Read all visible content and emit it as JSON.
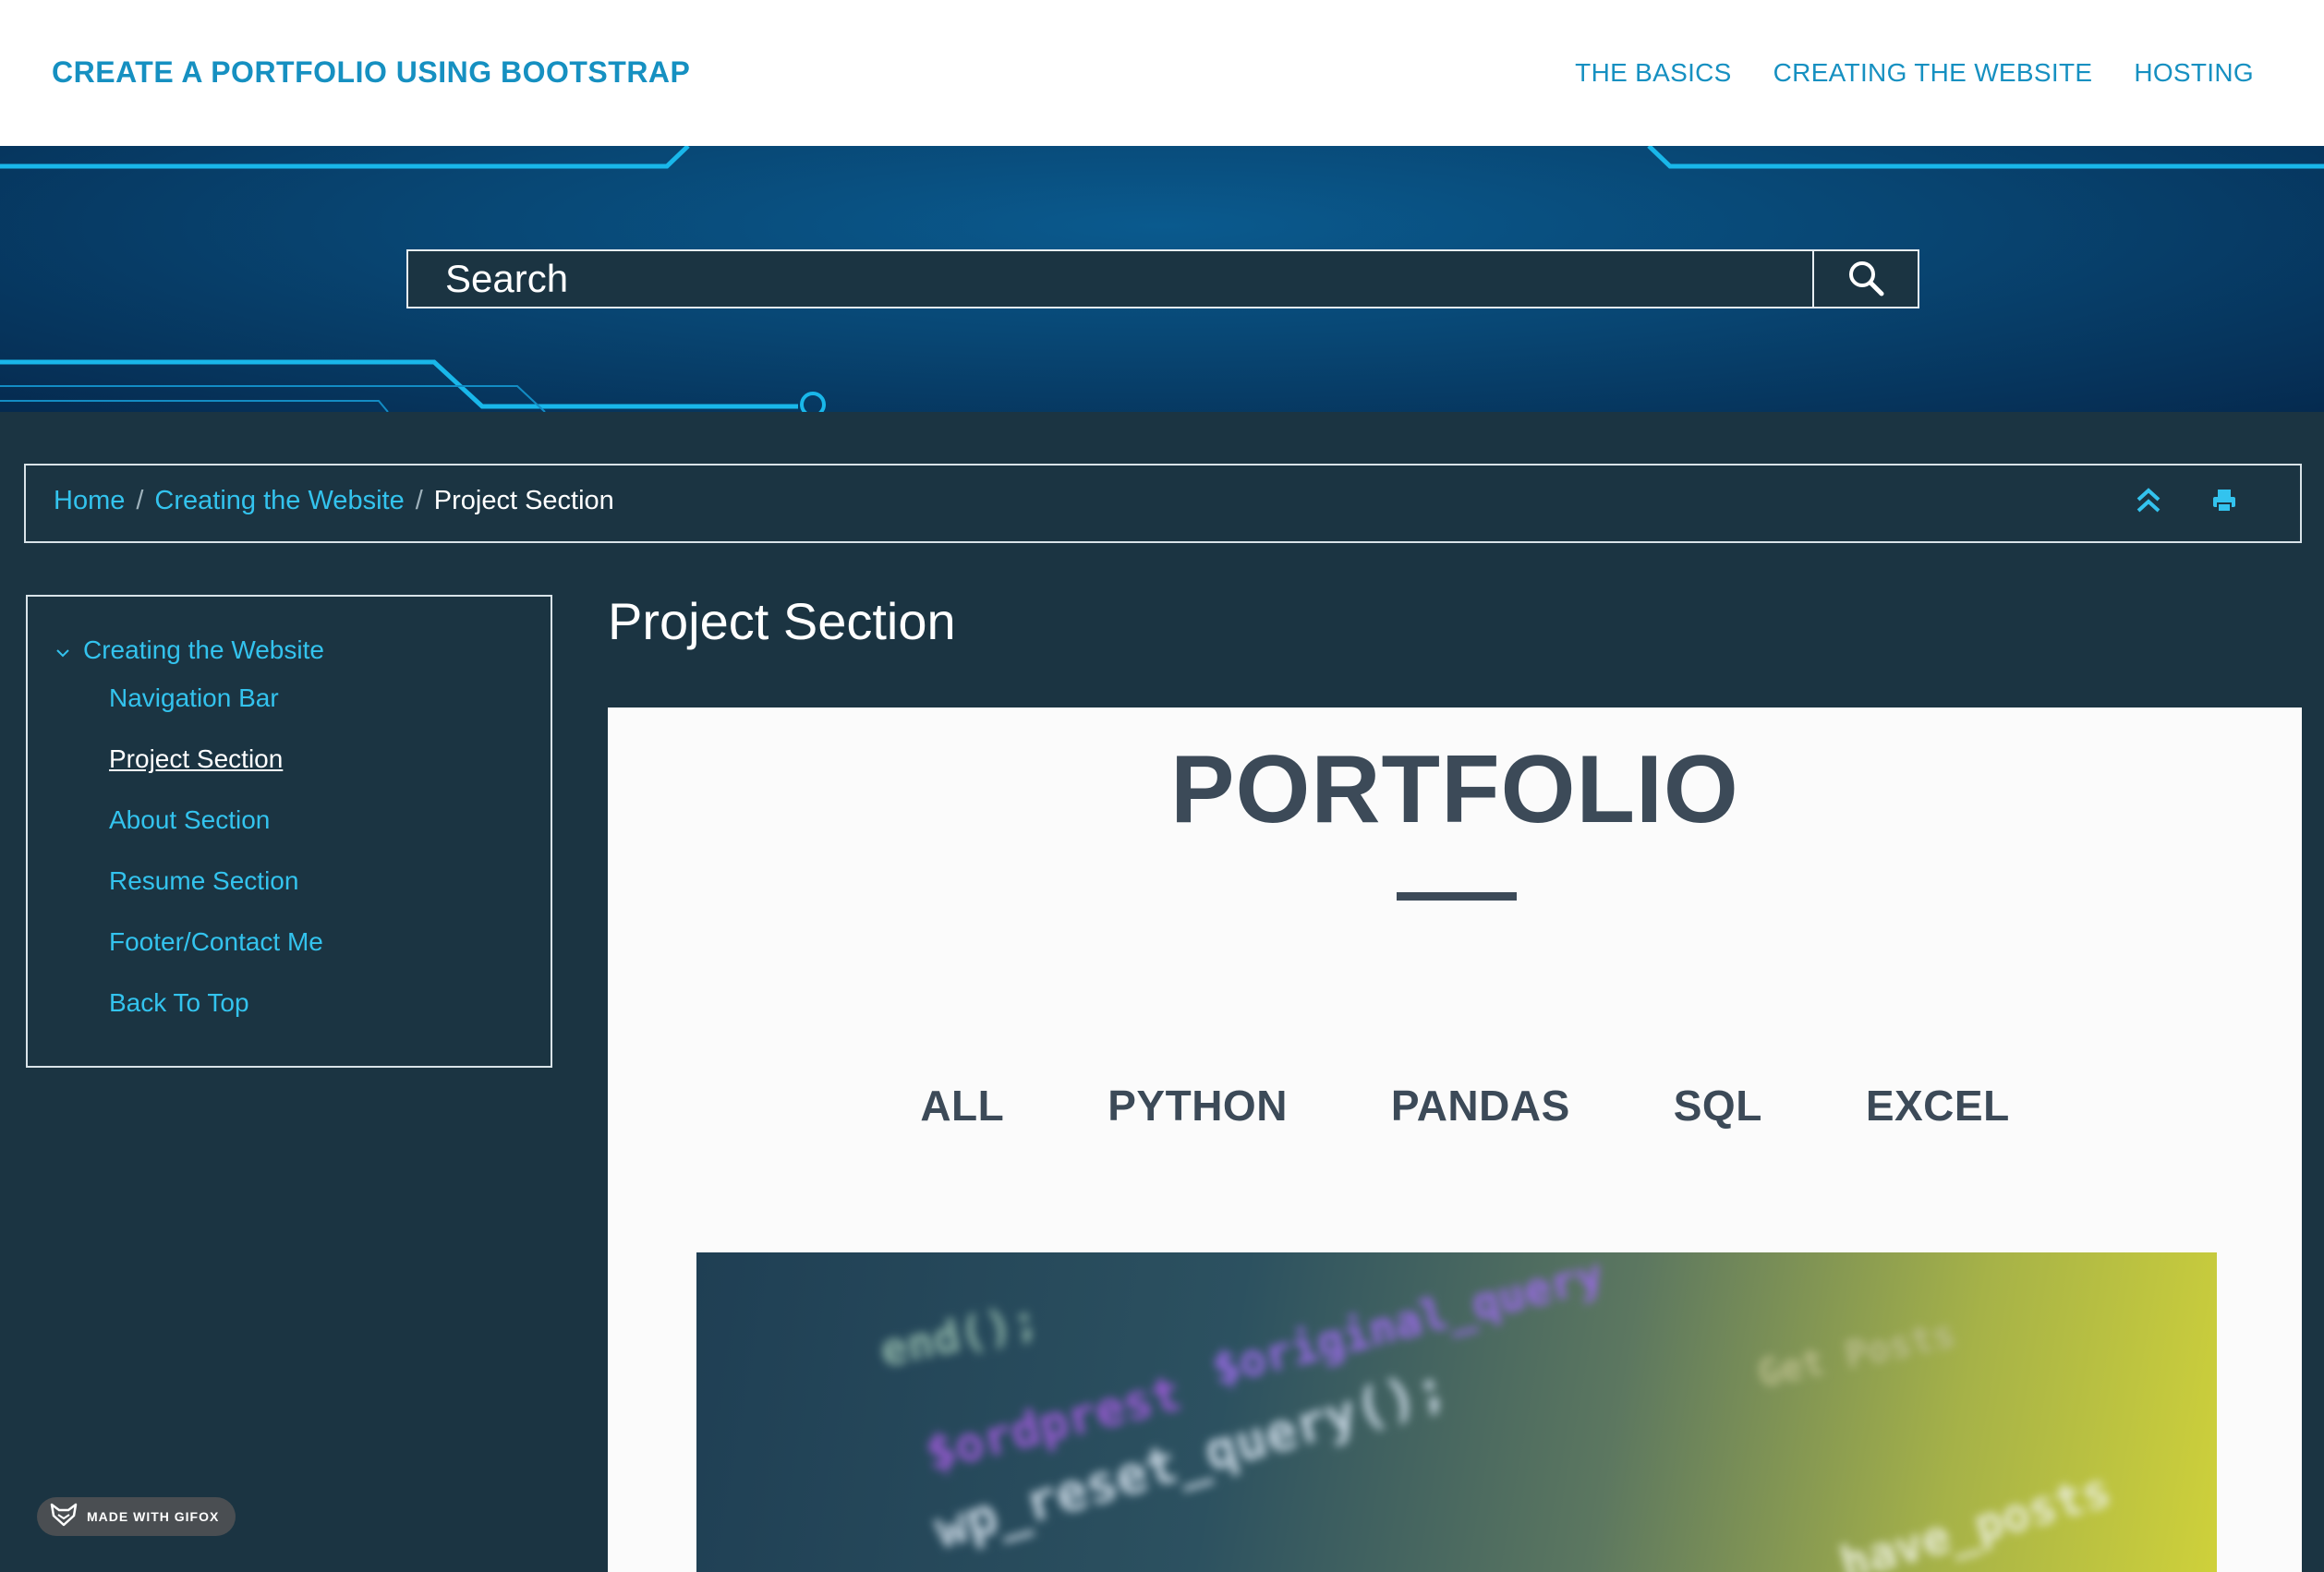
{
  "header": {
    "brand": "CREATE A PORTFOLIO USING BOOTSTRAP",
    "nav": [
      "THE BASICS",
      "CREATING THE WEBSITE",
      "HOSTING"
    ]
  },
  "search": {
    "placeholder": "Search",
    "button_icon": "search-icon"
  },
  "breadcrumb": {
    "items": [
      "Home",
      "Creating the Website"
    ],
    "current": "Project Section",
    "separator": "/",
    "tools": [
      "scroll-top-icon",
      "print-icon"
    ]
  },
  "sidebar": {
    "parent": "Creating the Website",
    "items": [
      {
        "label": "Navigation Bar",
        "active": false
      },
      {
        "label": "Project Section",
        "active": true
      },
      {
        "label": "About Section",
        "active": false
      },
      {
        "label": "Resume Section",
        "active": false
      },
      {
        "label": "Footer/Contact Me",
        "active": false
      },
      {
        "label": "Back To Top",
        "active": false
      }
    ]
  },
  "main": {
    "title": "Project Section",
    "portfolio_heading": "PORTFOLIO",
    "filters": [
      "ALL",
      "PYTHON",
      "PANDAS",
      "SQL",
      "EXCEL"
    ]
  },
  "project_image": {
    "code_text": [
      "end();",
      "Get Posts",
      "$ordprest",
      "$original_query",
      "wp_reset_query();",
      "have_posts"
    ]
  },
  "badge": {
    "text": "MADE WITH GIFOX"
  },
  "colors": {
    "accent": "#1690c1",
    "link": "#33c3ee",
    "page_bg": "#1b3442",
    "heading": "#3c4a58"
  }
}
